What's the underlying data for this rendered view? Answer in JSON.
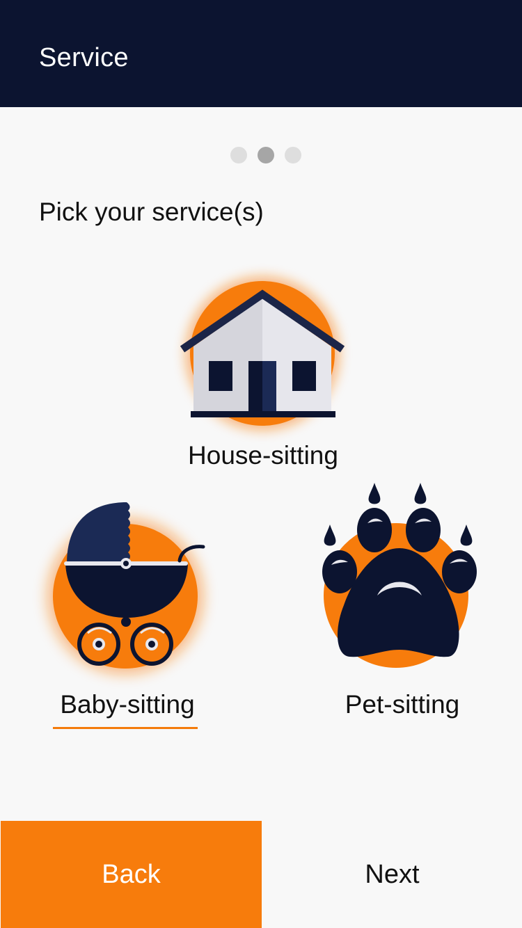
{
  "header": {
    "title": "Service"
  },
  "pager": {
    "total": 3,
    "active_index": 1
  },
  "prompt": "Pick your service(s)",
  "services": {
    "house": {
      "label": "House-sitting",
      "icon": "house-icon",
      "selected": false
    },
    "baby": {
      "label": "Baby-sitting",
      "icon": "stroller-icon",
      "selected": true
    },
    "pet": {
      "label": "Pet-sitting",
      "icon": "paw-icon",
      "selected": false
    }
  },
  "footer": {
    "back_label": "Back",
    "next_label": "Next"
  },
  "colors": {
    "header_bg": "#0c1430",
    "accent": "#f77c0c",
    "navy": "#0c1430",
    "background": "#f8f8f8"
  }
}
